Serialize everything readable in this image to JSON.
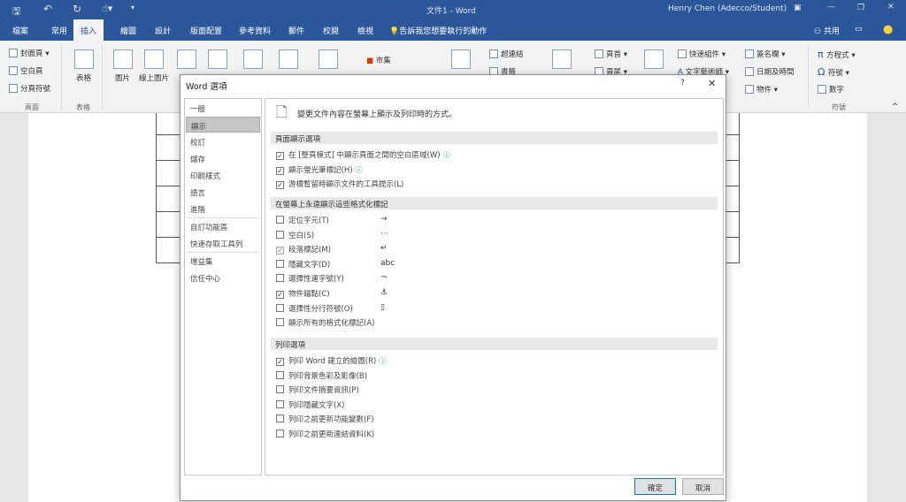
{
  "titlebar": {
    "title": "文件1 - Word",
    "user": "Henry Chen (Adecco/Student)"
  },
  "tabs": [
    "檔案",
    "常用",
    "插入",
    "繪圖",
    "設計",
    "版面配置",
    "參考資料",
    "郵件",
    "校閱",
    "檢視"
  ],
  "tell_me": "告訴我您想要執行的動作",
  "share": "共用",
  "ribbon": {
    "cover": "封面頁",
    "blank": "空白頁",
    "break": "分頁符號",
    "table": "表格",
    "picture": "圖片",
    "online_picture": "線上圖片",
    "store": "市集",
    "hyperlink": "超連結",
    "bookmark": "書籤",
    "header": "頁首",
    "footer": "頁尾",
    "quick_parts": "快速組件",
    "wordart": "文字藝術師",
    "signature": "簽名欄",
    "datetime": "日期及時間",
    "object": "物件",
    "equation": "方程式",
    "symbol": "符號",
    "number": "數字",
    "group_pages": "頁面",
    "group_tables": "表格",
    "group_symbols": "符號"
  },
  "dialog": {
    "title": "Word 選項",
    "help": "?",
    "close": "✕",
    "sidebar": [
      "一般",
      "顯示",
      "校訂",
      "儲存",
      "印刷樣式",
      "語言",
      "進階",
      "自訂功能區",
      "快速存取工具列",
      "增益集",
      "信任中心"
    ],
    "header": "變更文件內容在螢幕上顯示及列印時的方式。",
    "sections": [
      {
        "title": "頁面顯示選項",
        "options": [
          {
            "label": "在 [整頁模式] 中顯示頁面之間的空白區域(W)",
            "checked": true,
            "info": "ⓘ"
          },
          {
            "label": "顯示螢光筆標記(H)",
            "checked": true,
            "info": "ⓘ"
          },
          {
            "label": "游標暫留時顯示文件的工具提示(L)",
            "checked": true
          }
        ]
      },
      {
        "title": "在螢幕上永遠顯示這些格式化標記",
        "options": [
          {
            "label": "定位字元(T)",
            "checked": false,
            "symbol": "→"
          },
          {
            "label": "空白(S)",
            "checked": false,
            "symbol": "···"
          },
          {
            "label": "段落標記(M)",
            "checked": true,
            "disabled": true,
            "symbol": "↵"
          },
          {
            "label": "隱藏文字(D)",
            "checked": false,
            "symbol": "abc"
          },
          {
            "label": "選擇性連字號(Y)",
            "checked": false,
            "symbol": "¬"
          },
          {
            "label": "物件錨點(C)",
            "checked": true,
            "symbol": "⚓"
          },
          {
            "label": "選擇性分行符號(O)",
            "checked": false,
            "symbol": "▯"
          },
          {
            "label": "顯示所有的格式化標記(A)",
            "checked": false
          }
        ]
      },
      {
        "title": "列印選項",
        "options": [
          {
            "label": "列印 Word 建立的繪圖(R)",
            "checked": true,
            "info": "ⓘ"
          },
          {
            "label": "列印背景色彩及影像(B)",
            "checked": false
          },
          {
            "label": "列印文件摘要資訊(P)",
            "checked": false
          },
          {
            "label": "列印隱藏文字(X)",
            "checked": false
          },
          {
            "label": "列印之前更新功能變數(F)",
            "checked": false
          },
          {
            "label": "列印之前更新連結資料(K)",
            "checked": false
          }
        ]
      }
    ],
    "ok": "確定",
    "cancel": "取消"
  }
}
